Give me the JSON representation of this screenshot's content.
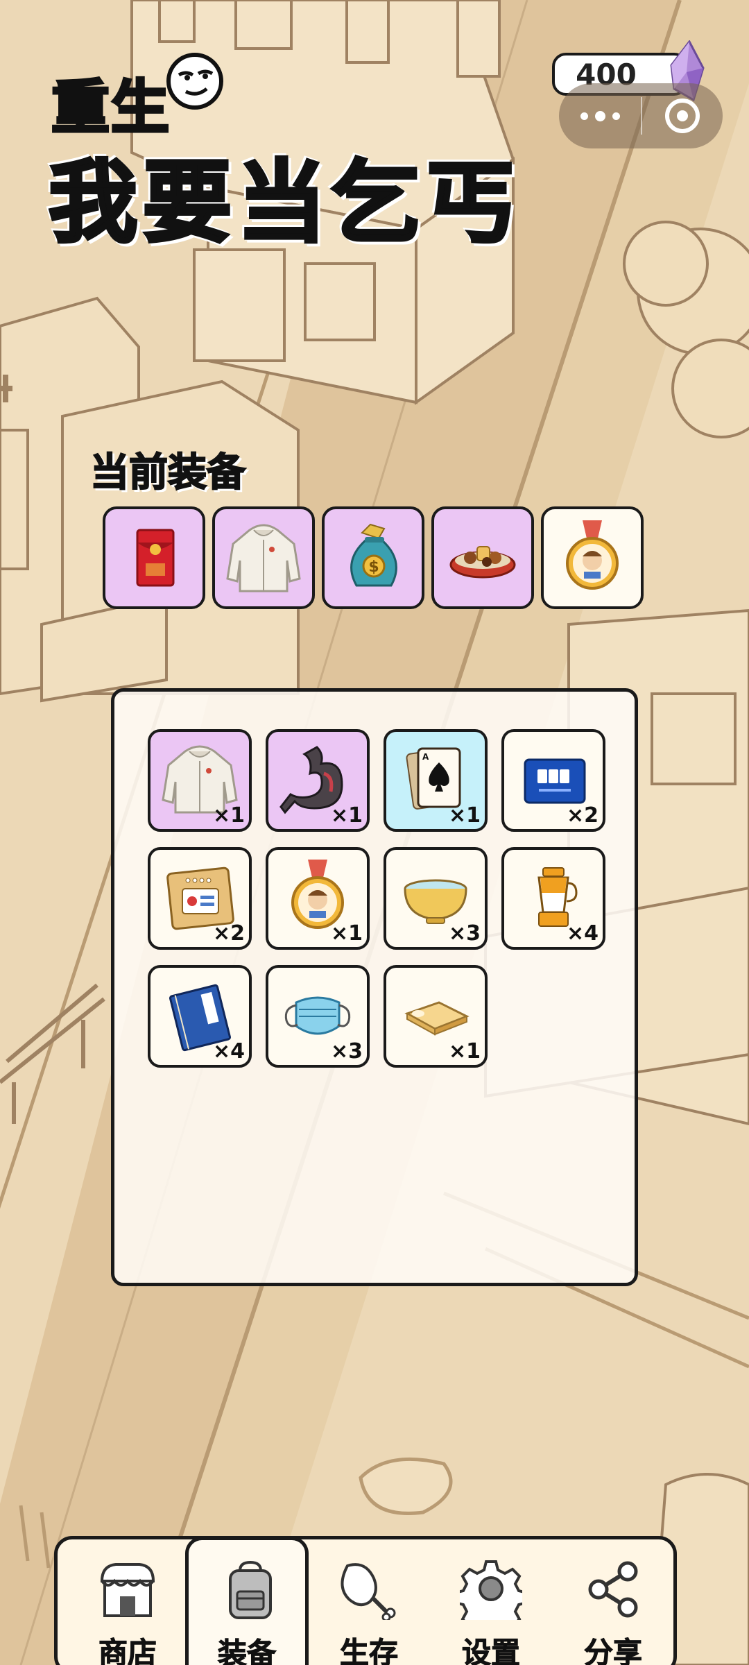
{
  "title": {
    "line1": "重生",
    "line2": "我要当乞丐"
  },
  "hud": {
    "gem_count": "400",
    "gem_icon": "purple-crystal-icon",
    "menu_icon": "more-dots-icon",
    "close_icon": "target-circle-icon"
  },
  "equipment": {
    "heading": "当前装备",
    "slots": [
      {
        "icon": "red-envelope-icon",
        "color": "#ebc6f4"
      },
      {
        "icon": "hoodie-icon",
        "color": "#ebc6f4"
      },
      {
        "icon": "money-bag-icon",
        "color": "#ebc6f4"
      },
      {
        "icon": "food-platter-icon",
        "color": "#ebc6f4"
      },
      {
        "icon": "medal-icon",
        "color": "#fffbf1"
      }
    ]
  },
  "inventory": {
    "items": [
      {
        "icon": "hoodie-icon",
        "count": "×1",
        "rarity": "purple"
      },
      {
        "icon": "stomach-icon",
        "count": "×1",
        "rarity": "purple"
      },
      {
        "icon": "ace-of-spades-card-icon",
        "count": "×1",
        "rarity": "cyan"
      },
      {
        "icon": "blue-card-icon",
        "count": "×2",
        "rarity": "cream"
      },
      {
        "icon": "ticket-card-icon",
        "count": "×2",
        "rarity": "cream"
      },
      {
        "icon": "medal-icon",
        "count": "×1",
        "rarity": "cream"
      },
      {
        "icon": "bowl-icon",
        "count": "×3",
        "rarity": "cream"
      },
      {
        "icon": "blender-icon",
        "count": "×4",
        "rarity": "cream"
      },
      {
        "icon": "book-icon",
        "count": "×4",
        "rarity": "cream"
      },
      {
        "icon": "face-mask-icon",
        "count": "×3",
        "rarity": "cream"
      },
      {
        "icon": "mattress-icon",
        "count": "×1",
        "rarity": "cream"
      }
    ]
  },
  "nav": {
    "items": [
      {
        "label": "商店",
        "icon": "shop-icon"
      },
      {
        "label": "装备",
        "icon": "backpack-icon",
        "active": true
      },
      {
        "label": "生存",
        "icon": "drumstick-icon"
      },
      {
        "label": "设置",
        "icon": "gear-icon"
      },
      {
        "label": "分享",
        "icon": "share-icon"
      }
    ]
  },
  "colors": {
    "background": "#e8d2ae",
    "rarity_purple": "#ebc6f4",
    "rarity_cyan": "#c6f1fa",
    "rarity_common": "#fffbf1"
  }
}
